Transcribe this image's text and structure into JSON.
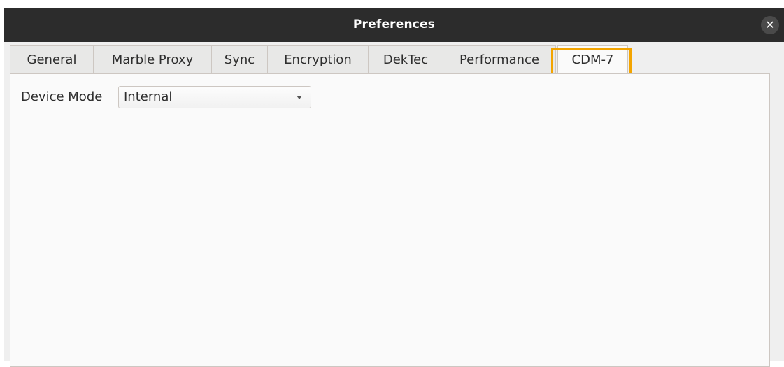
{
  "window": {
    "title": "Preferences",
    "close_glyph": "✕"
  },
  "tabs": [
    {
      "label": "General",
      "active": false
    },
    {
      "label": "Marble Proxy",
      "active": false
    },
    {
      "label": "Sync",
      "active": false
    },
    {
      "label": "Encryption",
      "active": false
    },
    {
      "label": "DekTec",
      "active": false
    },
    {
      "label": "Performance",
      "active": false
    },
    {
      "label": "CDM-7",
      "active": true
    }
  ],
  "cdm7": {
    "device_mode_label": "Device Mode",
    "device_mode_value": "Internal"
  },
  "colors": {
    "titlebar": "#2c2c2c",
    "highlight": "#f3a400",
    "window_bg": "#efefef",
    "panel_bg": "#fafafa"
  }
}
